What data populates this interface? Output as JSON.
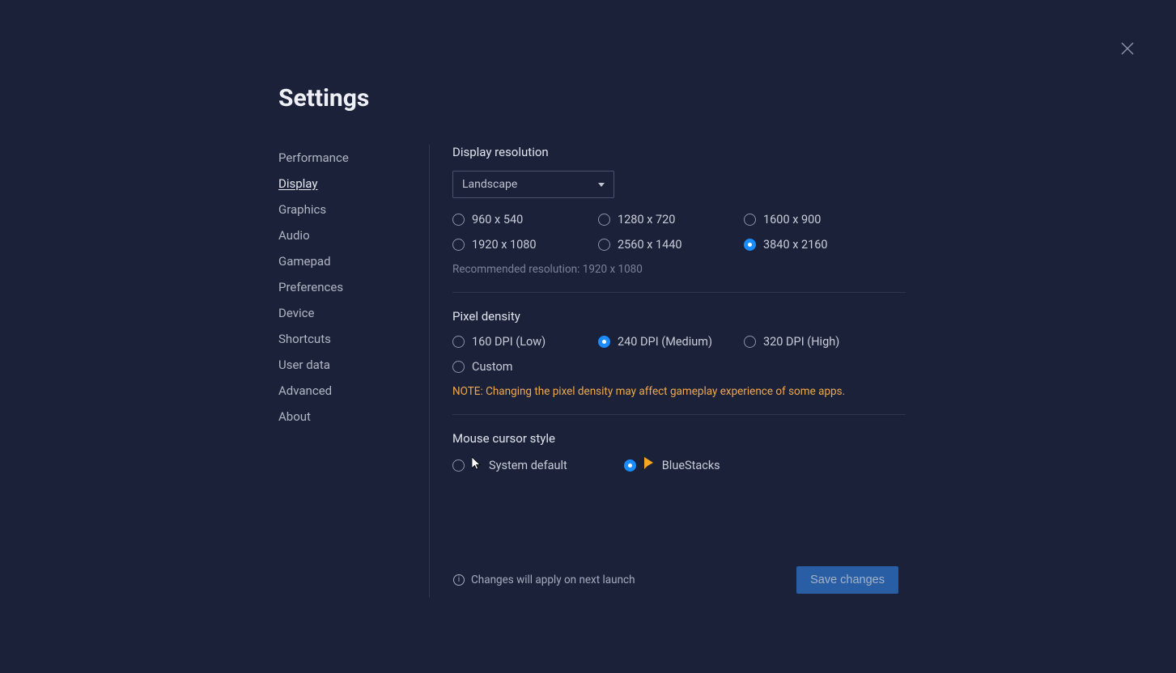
{
  "title": "Settings",
  "sidebar": {
    "items": [
      {
        "label": "Performance"
      },
      {
        "label": "Display"
      },
      {
        "label": "Graphics"
      },
      {
        "label": "Audio"
      },
      {
        "label": "Gamepad"
      },
      {
        "label": "Preferences"
      },
      {
        "label": "Device"
      },
      {
        "label": "Shortcuts"
      },
      {
        "label": "User data"
      },
      {
        "label": "Advanced"
      },
      {
        "label": "About"
      }
    ],
    "active_index": 1
  },
  "display": {
    "resolution": {
      "title": "Display resolution",
      "dropdown_value": "Landscape",
      "options": [
        "960 x 540",
        "1280 x 720",
        "1600 x 900",
        "1920 x 1080",
        "2560 x 1440",
        "3840 x 2160"
      ],
      "selected_index": 5,
      "recommended": "Recommended resolution: 1920 x 1080"
    },
    "pixel_density": {
      "title": "Pixel density",
      "options": [
        "160 DPI (Low)",
        "240 DPI (Medium)",
        "320 DPI (High)",
        "Custom"
      ],
      "selected_index": 1,
      "note": "NOTE: Changing the pixel density may affect gameplay experience of some apps."
    },
    "cursor": {
      "title": "Mouse cursor style",
      "options": [
        "System default",
        "BlueStacks"
      ],
      "selected_index": 1
    }
  },
  "footer": {
    "note": "Changes will apply on next launch",
    "save_label": "Save changes"
  }
}
